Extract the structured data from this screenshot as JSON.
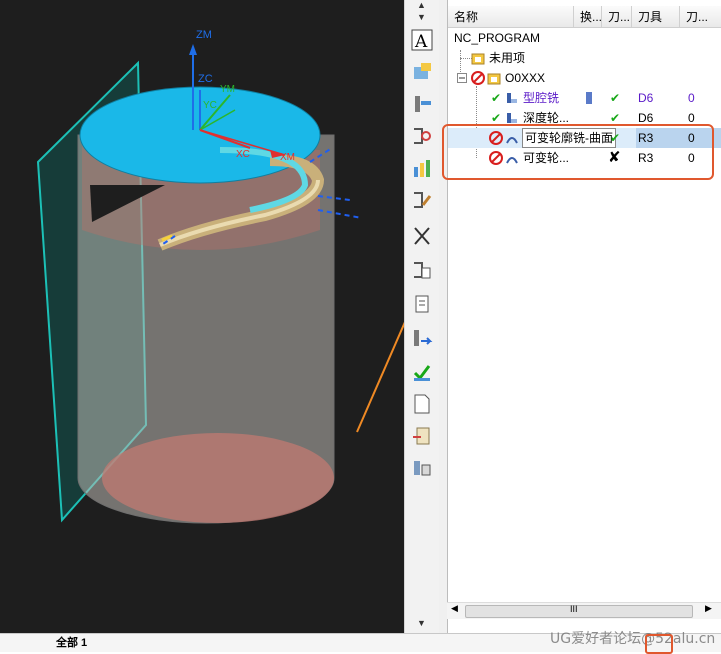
{
  "navigator": {
    "columns": [
      "名称",
      "换...",
      "刀...",
      "刀具",
      "刀..."
    ],
    "rows": [
      {
        "name": "NC_PROGRAM",
        "c2": "",
        "c3": "",
        "tool": "",
        "c5": ""
      },
      {
        "name": "未用项",
        "c2": "",
        "c3": "",
        "tool": "",
        "c5": ""
      },
      {
        "name": "O0XXX",
        "c2": "",
        "c3": "",
        "tool": "",
        "c5": ""
      },
      {
        "name": "型腔铣",
        "c2": "",
        "c3": "✔",
        "tool": "D6",
        "c5": "0"
      },
      {
        "name": "深度轮...",
        "c2": "",
        "c3": "✔",
        "tool": "D6",
        "c5": "0"
      },
      {
        "name": "可变轮廓铣-曲面",
        "c2": "",
        "c3": "✔",
        "tool": "R3",
        "c5": "0"
      },
      {
        "name": "可变轮...",
        "c2": "",
        "c3": "✘",
        "tool": "R3",
        "c5": "0"
      }
    ],
    "scroll_grip": "III"
  },
  "viewport": {
    "labels": {
      "zm": "ZM",
      "zc": "ZC",
      "ym": "YM",
      "yc": "YC",
      "xc": "XC",
      "xm": "XM"
    }
  },
  "status": {
    "left_text": "全部 1"
  },
  "watermark": "UG爱好者论坛@52alu.cn",
  "colors": {
    "cylinder_top": "#1ab8e8",
    "cylinder_bottom": "#c27a72",
    "wcs_blue": "#1f6ee8",
    "highlight_box": "#e0582e",
    "check_green": "#18a818"
  }
}
